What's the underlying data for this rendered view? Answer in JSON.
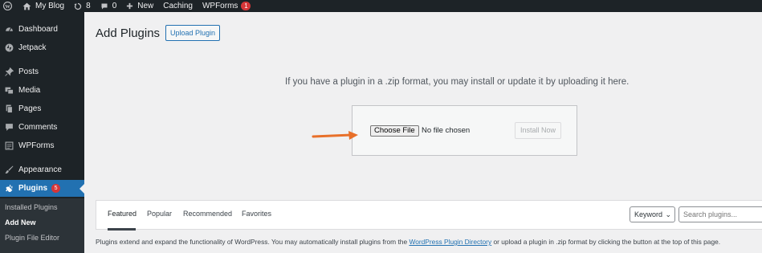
{
  "adminbar": {
    "site_name": "My Blog",
    "updates_count": "8",
    "comments_count": "0",
    "new_label": "New",
    "caching_label": "Caching",
    "wpforms_label": "WPForms",
    "wpforms_badge": "1"
  },
  "sidebar": {
    "items": [
      {
        "label": "Dashboard",
        "icon": "dashboard-icon"
      },
      {
        "label": "Jetpack",
        "icon": "jetpack-icon"
      },
      {
        "label": "Posts",
        "icon": "pin-icon"
      },
      {
        "label": "Media",
        "icon": "media-icon"
      },
      {
        "label": "Pages",
        "icon": "pages-icon"
      },
      {
        "label": "Comments",
        "icon": "comment-icon"
      },
      {
        "label": "WPForms",
        "icon": "wpforms-icon"
      },
      {
        "label": "Appearance",
        "icon": "brush-icon"
      },
      {
        "label": "Plugins",
        "icon": "plugin-icon",
        "badge": "5"
      }
    ],
    "submenu": [
      {
        "label": "Installed Plugins"
      },
      {
        "label": "Add New"
      },
      {
        "label": "Plugin File Editor"
      }
    ]
  },
  "main": {
    "title": "Add Plugins",
    "upload_button": "Upload Plugin",
    "upload_help": "If you have a plugin in a .zip format, you may install or update it by uploading it here.",
    "choose_file": "Choose File",
    "no_file": "No file chosen",
    "install_now": "Install Now"
  },
  "filter": {
    "tabs": [
      "Featured",
      "Popular",
      "Recommended",
      "Favorites"
    ],
    "search_type": "Keyword",
    "search_placeholder": "Search plugins..."
  },
  "footer": {
    "desc_before": "Plugins extend and expand the functionality of WordPress. You may automatically install plugins from the ",
    "link_text": "WordPress Plugin Directory",
    "desc_after": " or upload a plugin in .zip format by clicking the button at the top of this page."
  },
  "colors": {
    "admin_dark": "#1d2327",
    "accent_blue": "#2271b1",
    "badge_red": "#d63638",
    "arrow_orange": "#e8702a"
  }
}
